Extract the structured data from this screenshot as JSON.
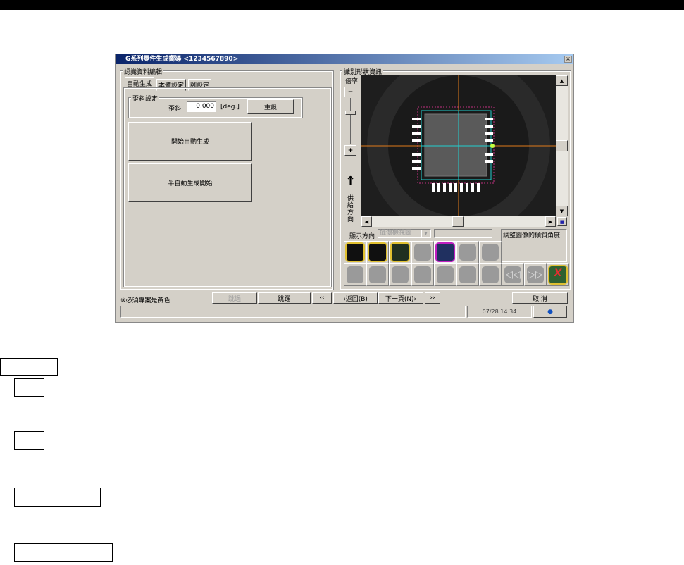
{
  "window": {
    "title": "G系列零件生成嚮導 <1234567890>",
    "close": "×"
  },
  "left": {
    "group_title": "認識資料編輯",
    "tabs": [
      "自動生成",
      "本體設定",
      "腳設定"
    ],
    "skew_group": "歪斜設定",
    "skew_label": "歪斜",
    "skew_value": "0.000",
    "skew_unit": "[deg.]",
    "reset": "重設",
    "start_auto": "開始自動生成",
    "semi_auto": "半自動生成開始"
  },
  "right": {
    "group_title": "識別形狀資訊",
    "zoom_label": "倍率",
    "feed_direction": "供給方向",
    "display_direction_label": "顯示方向",
    "display_direction_value": "攝像機視圖",
    "info_text": "調整圖像的傾斜角度"
  },
  "bottom": {
    "note": "※必須專案是黃色",
    "skip": "跳過",
    "jump": "跳躍",
    "first": "‹‹",
    "back": "‹返回(B)",
    "next": "下一頁(N)›",
    "last": "››",
    "cancel": "取 消",
    "datetime": "07/28 14:34"
  },
  "colors": {
    "titlebar": "#0a246a",
    "crosshair": "#e07a1a",
    "roi": "#22d0d0"
  }
}
